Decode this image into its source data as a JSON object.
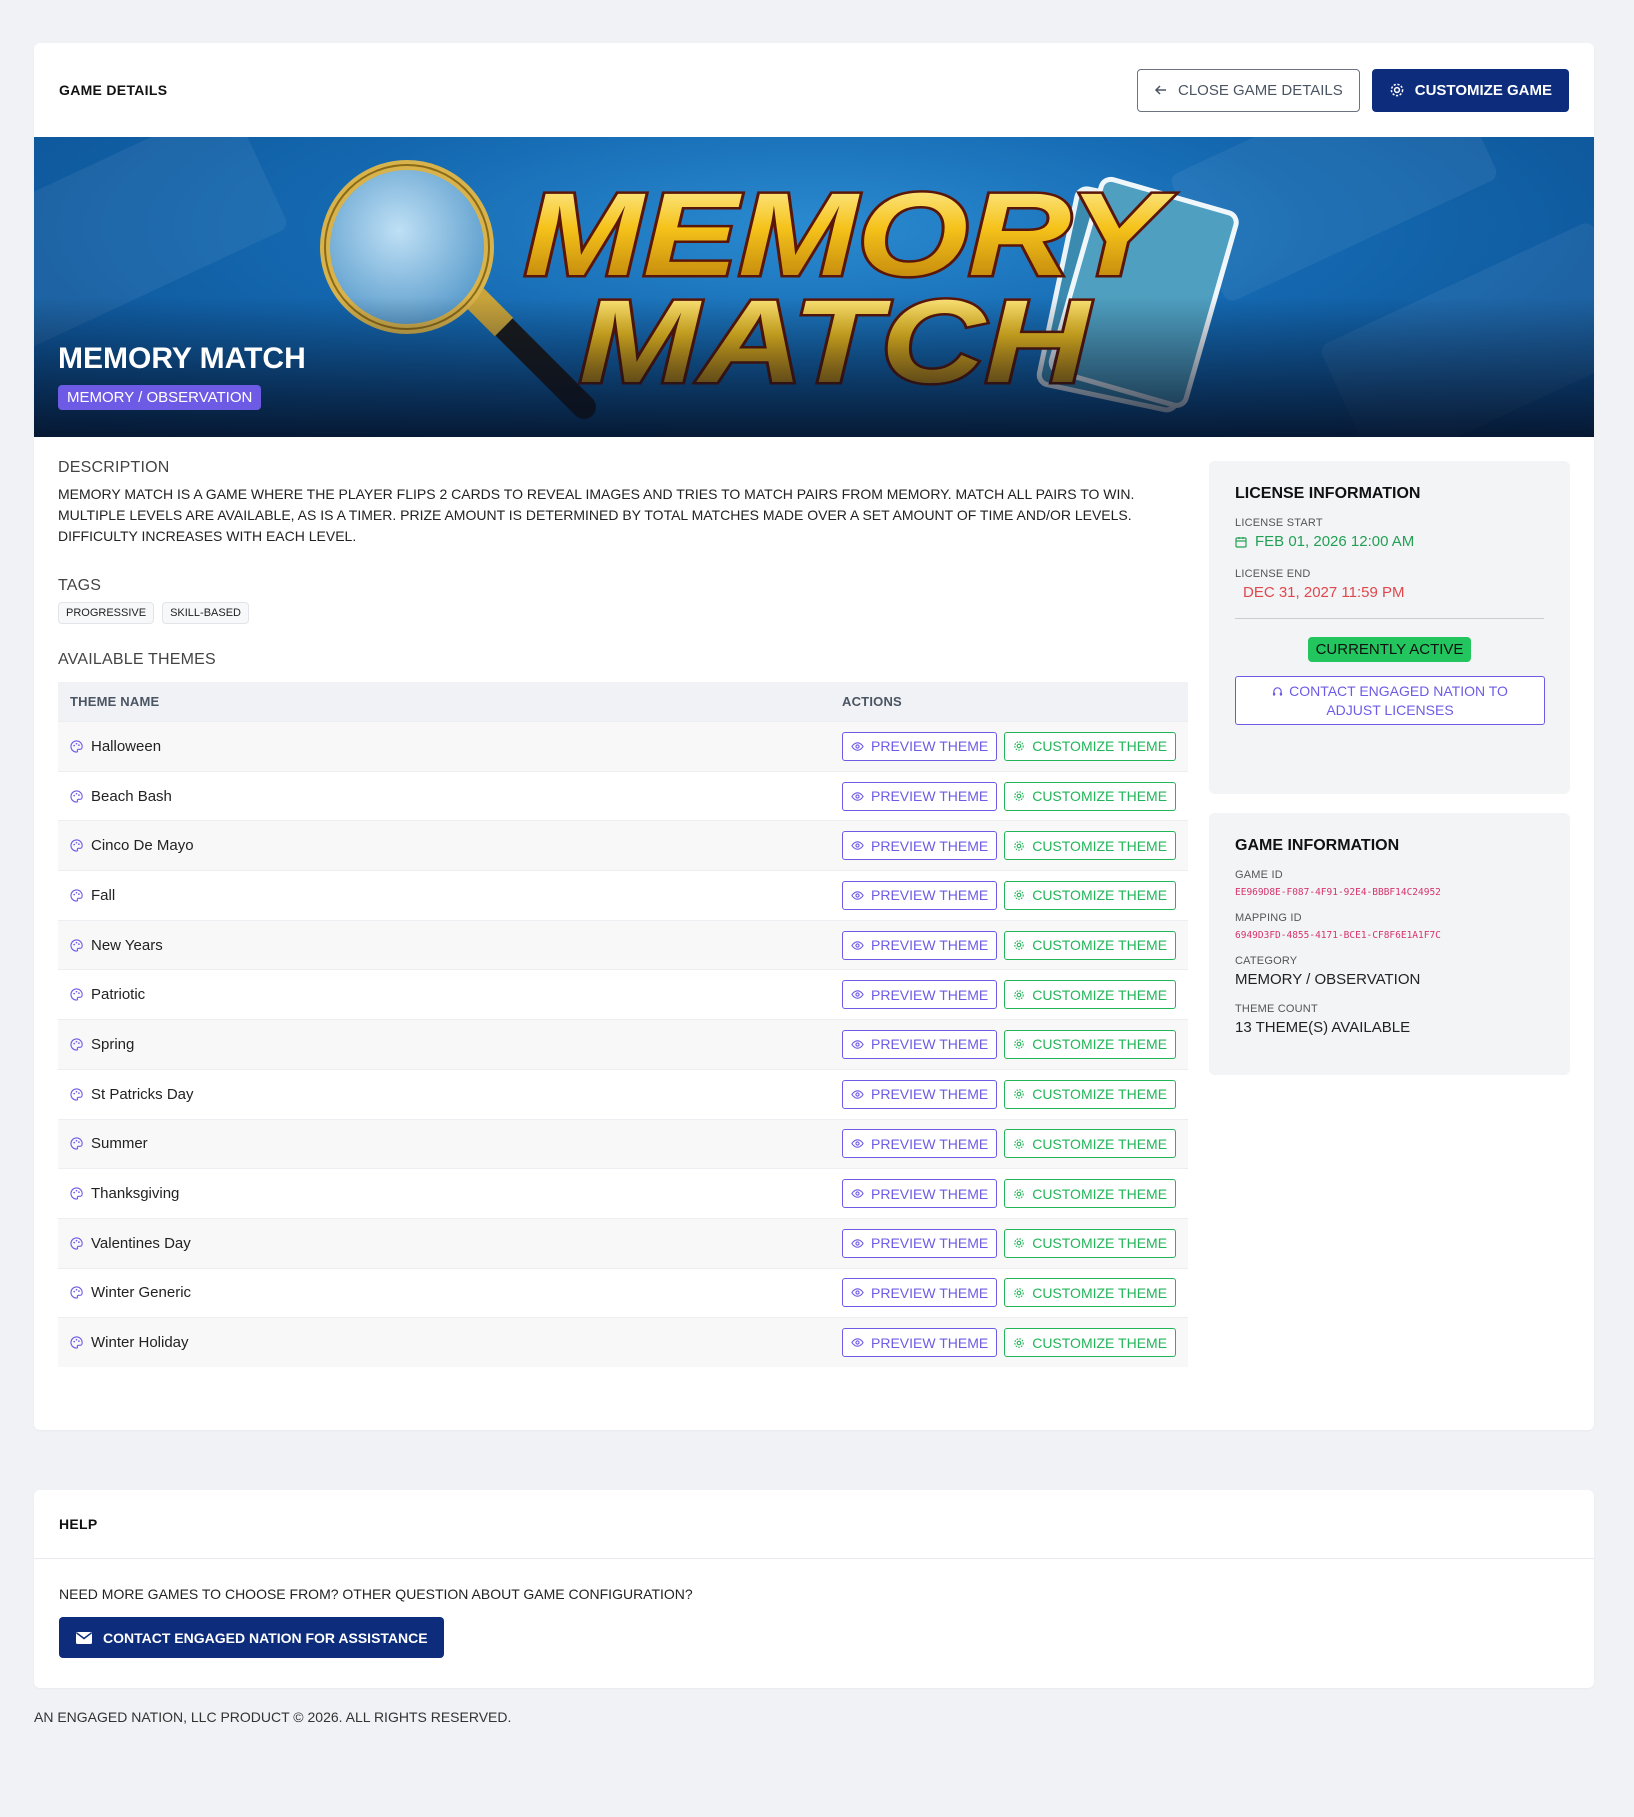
{
  "header": {
    "title": "GAME DETAILS",
    "close_label": "CLOSE GAME DETAILS",
    "customize_label": "CUSTOMIZE GAME"
  },
  "banner": {
    "logo_line1": "MEMORY",
    "logo_line2": "MATCH",
    "game_title": "MEMORY MATCH",
    "category": "MEMORY / OBSERVATION"
  },
  "description": {
    "label": "DESCRIPTION",
    "text": "MEMORY MATCH IS A GAME WHERE THE PLAYER FLIPS 2 CARDS TO REVEAL IMAGES AND TRIES TO MATCH PAIRS FROM MEMORY. MATCH ALL PAIRS TO WIN. MULTIPLE LEVELS ARE AVAILABLE, AS IS A TIMER. PRIZE AMOUNT IS DETERMINED BY TOTAL MATCHES MADE OVER A SET AMOUNT OF TIME AND/OR LEVELS. DIFFICULTY INCREASES WITH EACH LEVEL."
  },
  "tags": {
    "label": "TAGS",
    "items": [
      "PROGRESSIVE",
      "SKILL-BASED"
    ]
  },
  "themes": {
    "label": "AVAILABLE THEMES",
    "columns": [
      "THEME NAME",
      "ACTIONS"
    ],
    "preview_label": "PREVIEW THEME",
    "customize_label": "CUSTOMIZE THEME",
    "rows": [
      "Halloween",
      "Beach Bash",
      "Cinco De Mayo",
      "Fall",
      "New Years",
      "Patriotic",
      "Spring",
      "St Patricks Day",
      "Summer",
      "Thanksgiving",
      "Valentines Day",
      "Winter Generic",
      "Winter Holiday"
    ]
  },
  "license": {
    "title": "LICENSE INFORMATION",
    "start_label": "LICENSE START",
    "start_value": "FEB 01, 2026 12:00 AM",
    "end_label": "LICENSE END",
    "end_value": "DEC 31, 2027 11:59 PM",
    "status": "CURRENTLY ACTIVE",
    "contact_label": "CONTACT ENGAGED NATION TO ADJUST LICENSES"
  },
  "game_info": {
    "title": "GAME INFORMATION",
    "game_id_label": "GAME ID",
    "game_id": "EE969D8E-F087-4F91-92E4-BBBF14C24952",
    "mapping_id_label": "MAPPING ID",
    "mapping_id": "6949D3FD-4855-4171-BCE1-CF8F6E1A1F7C",
    "category_label": "CATEGORY",
    "category": "MEMORY / OBSERVATION",
    "theme_count_label": "THEME COUNT",
    "theme_count": "13 THEME(S) AVAILABLE"
  },
  "help": {
    "title": "HELP",
    "text": "NEED MORE GAMES TO CHOOSE FROM? OTHER QUESTION ABOUT GAME CONFIGURATION?",
    "button_label": "CONTACT ENGAGED NATION FOR ASSISTANCE"
  },
  "footer": {
    "text": "AN ENGAGED NATION, LLC PRODUCT © 2026. ALL RIGHTS RESERVED."
  },
  "colors": {
    "primary": "#0d2c7c",
    "purple": "#6d5be6",
    "green": "#22b559",
    "red": "#e0474c",
    "active": "#22c55e"
  },
  "icons": {
    "close": "arrow-left-icon",
    "customize": "gear-icon",
    "preview": "eye-icon",
    "theme": "palette-icon",
    "calendar": "calendar-icon",
    "headset": "headset-icon",
    "mail": "envelope-icon"
  }
}
